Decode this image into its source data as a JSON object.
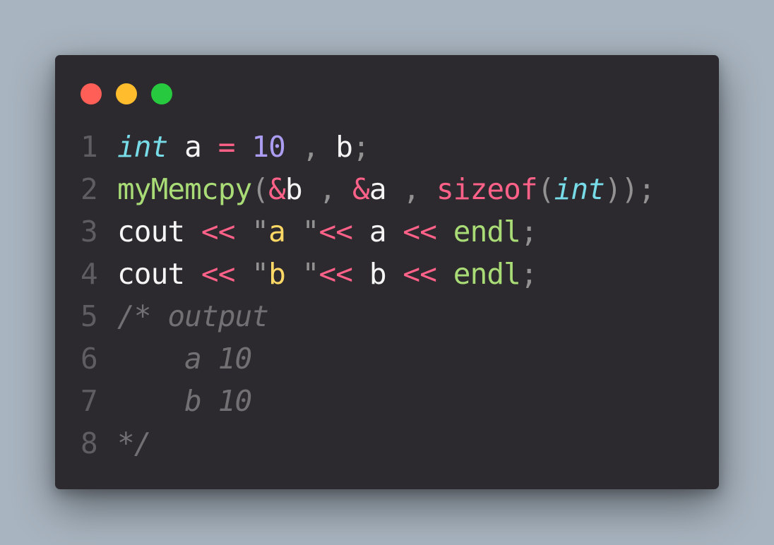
{
  "window": {
    "controls": {
      "close_color": "#ff5f56",
      "minimize_color": "#ffbd2e",
      "maximize_color": "#27c93f"
    }
  },
  "theme": {
    "background": "#2c2a2e",
    "keyword": "#78dce8",
    "number": "#ab9df2",
    "operator": "#ff6188",
    "function": "#a9dc76",
    "string": "#ffd866",
    "comment": "#727072"
  },
  "code": {
    "lines": [
      {
        "number": "1",
        "tokens": [
          {
            "t": "int",
            "k": "kw"
          },
          {
            "t": " a ",
            "k": "src"
          },
          {
            "t": "=",
            "k": "op"
          },
          {
            "t": " ",
            "k": "src"
          },
          {
            "t": "10",
            "k": "num"
          },
          {
            "t": " ",
            "k": "src"
          },
          {
            "t": ",",
            "k": "punc"
          },
          {
            "t": " b",
            "k": "src"
          },
          {
            "t": ";",
            "k": "punc"
          }
        ]
      },
      {
        "number": "2",
        "tokens": [
          {
            "t": "myMemcpy",
            "k": "fn"
          },
          {
            "t": "(",
            "k": "punc"
          },
          {
            "t": "&",
            "k": "op"
          },
          {
            "t": "b ",
            "k": "src"
          },
          {
            "t": ",",
            "k": "punc"
          },
          {
            "t": " ",
            "k": "src"
          },
          {
            "t": "&",
            "k": "op"
          },
          {
            "t": "a ",
            "k": "src"
          },
          {
            "t": ",",
            "k": "punc"
          },
          {
            "t": " ",
            "k": "src"
          },
          {
            "t": "sizeof",
            "k": "op"
          },
          {
            "t": "(",
            "k": "punc"
          },
          {
            "t": "int",
            "k": "kw"
          },
          {
            "t": "));",
            "k": "punc"
          }
        ]
      },
      {
        "number": "3",
        "tokens": [
          {
            "t": "cout ",
            "k": "src"
          },
          {
            "t": "<<",
            "k": "op"
          },
          {
            "t": " ",
            "k": "src"
          },
          {
            "t": "\"",
            "k": "punc"
          },
          {
            "t": "a ",
            "k": "str"
          },
          {
            "t": "\"",
            "k": "punc"
          },
          {
            "t": "<<",
            "k": "op"
          },
          {
            "t": " a ",
            "k": "src"
          },
          {
            "t": "<<",
            "k": "op"
          },
          {
            "t": " ",
            "k": "src"
          },
          {
            "t": "endl",
            "k": "fn"
          },
          {
            "t": ";",
            "k": "punc"
          }
        ]
      },
      {
        "number": "4",
        "tokens": [
          {
            "t": "cout ",
            "k": "src"
          },
          {
            "t": "<<",
            "k": "op"
          },
          {
            "t": " ",
            "k": "src"
          },
          {
            "t": "\"",
            "k": "punc"
          },
          {
            "t": "b ",
            "k": "str"
          },
          {
            "t": "\"",
            "k": "punc"
          },
          {
            "t": "<<",
            "k": "op"
          },
          {
            "t": " b ",
            "k": "src"
          },
          {
            "t": "<<",
            "k": "op"
          },
          {
            "t": " ",
            "k": "src"
          },
          {
            "t": "endl",
            "k": "fn"
          },
          {
            "t": ";",
            "k": "punc"
          }
        ]
      },
      {
        "number": "5",
        "tokens": [
          {
            "t": "/* output",
            "k": "cm"
          }
        ]
      },
      {
        "number": "6",
        "tokens": [
          {
            "t": "    a 10",
            "k": "cm"
          }
        ]
      },
      {
        "number": "7",
        "tokens": [
          {
            "t": "    b 10",
            "k": "cm"
          }
        ]
      },
      {
        "number": "8",
        "tokens": [
          {
            "t": "*/",
            "k": "cm"
          }
        ]
      }
    ]
  }
}
